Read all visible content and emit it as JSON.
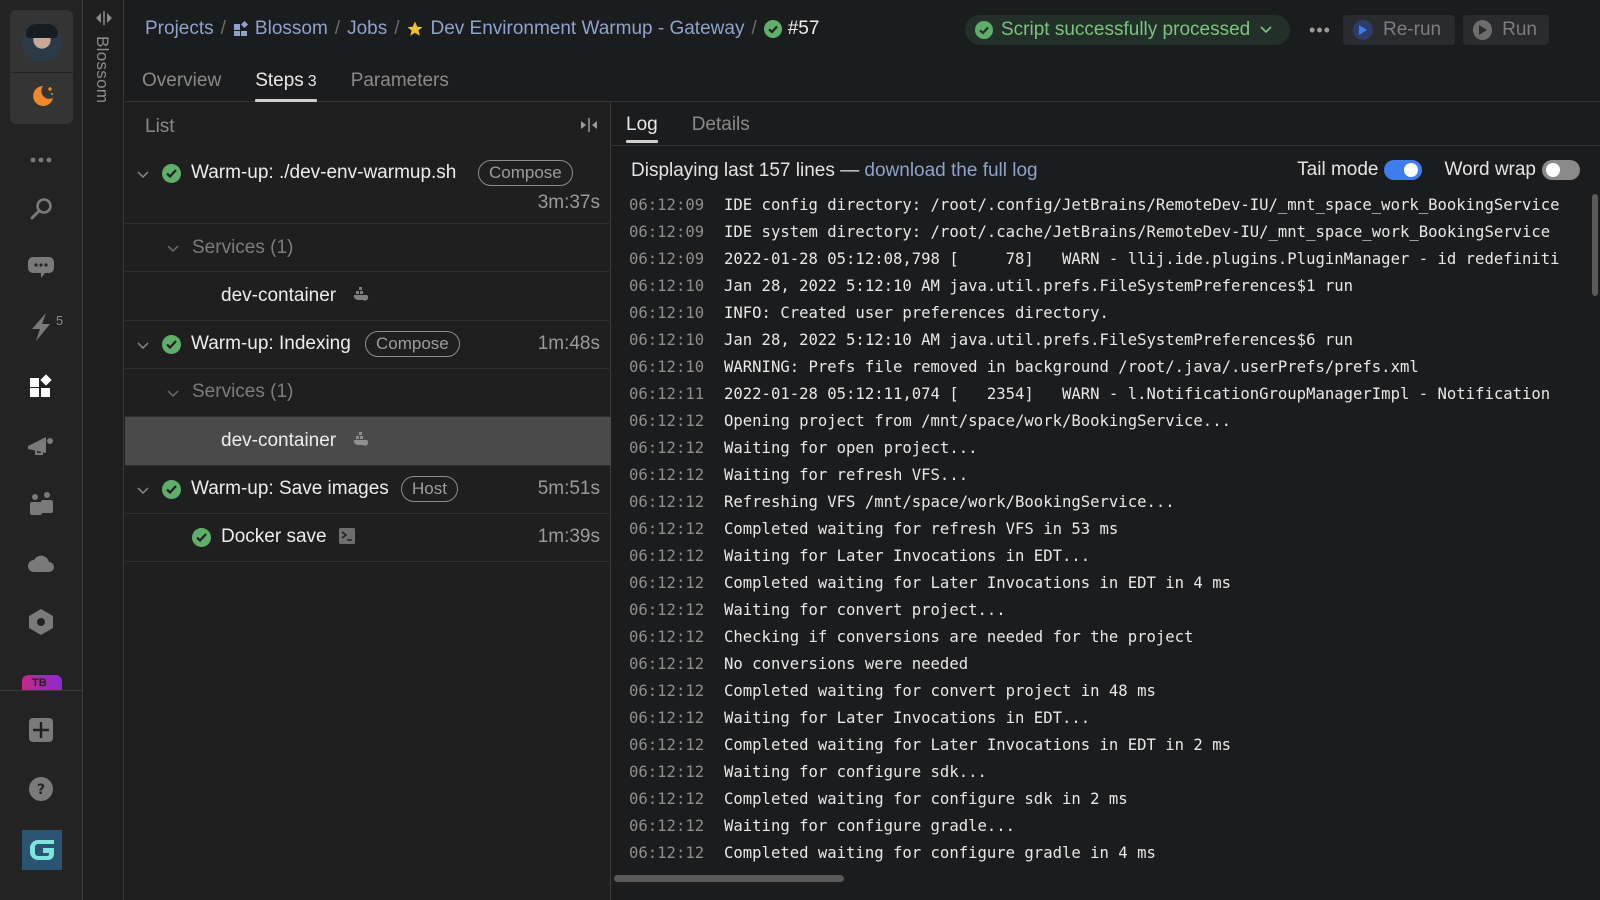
{
  "project_strip": {
    "label": "Blossom"
  },
  "rail": {
    "notifications_badge": "5",
    "tile_initials": "TB"
  },
  "header": {
    "breadcrumb": [
      "Projects",
      "Blossom",
      "Jobs",
      "Dev Environment Warmup - Gateway",
      "#57"
    ],
    "status": "Script successfully processed",
    "rerun_label": "Re-run",
    "run_label": "Run",
    "more_label": "•••"
  },
  "tabs": [
    {
      "label": "Overview"
    },
    {
      "label": "Steps",
      "count": "3"
    },
    {
      "label": "Parameters"
    }
  ],
  "list": {
    "header": "List",
    "steps": [
      {
        "title": "Warm-up: ./dev-env-warmup.sh",
        "tag": "Compose",
        "duration": "3m:37s",
        "services_label": "Services (1)",
        "service": "dev-container"
      },
      {
        "title": "Warm-up: Indexing",
        "tag": "Compose",
        "duration": "1m:48s",
        "services_label": "Services (1)",
        "service": "dev-container"
      },
      {
        "title": "Warm-up: Save images",
        "tag": "Host",
        "duration": "5m:51s",
        "substep": {
          "title": "Docker save",
          "duration": "1m:39s"
        }
      }
    ]
  },
  "log": {
    "tabs": [
      "Log",
      "Details"
    ],
    "info_prefix": "Displaying last 157 lines — ",
    "info_link": "download the full log",
    "tail_mode_label": "Tail mode",
    "tail_mode_on": true,
    "word_wrap_label": "Word wrap",
    "word_wrap_on": false,
    "lines": [
      {
        "ts": "06:12:09",
        "msg": "IDE config directory: /root/.config/JetBrains/RemoteDev-IU/_mnt_space_work_BookingService"
      },
      {
        "ts": "06:12:09",
        "msg": "IDE system directory: /root/.cache/JetBrains/RemoteDev-IU/_mnt_space_work_BookingService"
      },
      {
        "ts": "06:12:09",
        "msg": "2022-01-28 05:12:08,798 [     78]   WARN - llij.ide.plugins.PluginManager - id redefiniti"
      },
      {
        "ts": "06:12:10",
        "msg": "Jan 28, 2022 5:12:10 AM java.util.prefs.FileSystemPreferences$1 run"
      },
      {
        "ts": "06:12:10",
        "msg": "INFO: Created user preferences directory."
      },
      {
        "ts": "06:12:10",
        "msg": "Jan 28, 2022 5:12:10 AM java.util.prefs.FileSystemPreferences$6 run"
      },
      {
        "ts": "06:12:10",
        "msg": "WARNING: Prefs file removed in background /root/.java/.userPrefs/prefs.xml"
      },
      {
        "ts": "06:12:11",
        "msg": "2022-01-28 05:12:11,074 [   2354]   WARN - l.NotificationGroupManagerImpl - Notification"
      },
      {
        "ts": "06:12:12",
        "msg": "Opening project from /mnt/space/work/BookingService..."
      },
      {
        "ts": "06:12:12",
        "msg": "Waiting for open project..."
      },
      {
        "ts": "06:12:12",
        "msg": "Waiting for refresh VFS..."
      },
      {
        "ts": "06:12:12",
        "msg": "Refreshing VFS /mnt/space/work/BookingService..."
      },
      {
        "ts": "06:12:12",
        "msg": "Completed waiting for refresh VFS in 53 ms"
      },
      {
        "ts": "06:12:12",
        "msg": "Waiting for Later Invocations in EDT..."
      },
      {
        "ts": "06:12:12",
        "msg": "Completed waiting for Later Invocations in EDT in 4 ms"
      },
      {
        "ts": "06:12:12",
        "msg": "Waiting for convert project..."
      },
      {
        "ts": "06:12:12",
        "msg": "Checking if conversions are needed for the project"
      },
      {
        "ts": "06:12:12",
        "msg": "No conversions were needed"
      },
      {
        "ts": "06:12:12",
        "msg": "Completed waiting for convert project in 48 ms"
      },
      {
        "ts": "06:12:12",
        "msg": "Waiting for Later Invocations in EDT..."
      },
      {
        "ts": "06:12:12",
        "msg": "Completed waiting for Later Invocations in EDT in 2 ms"
      },
      {
        "ts": "06:12:12",
        "msg": "Waiting for configure sdk..."
      },
      {
        "ts": "06:12:12",
        "msg": "Completed waiting for configure sdk in 2 ms"
      },
      {
        "ts": "06:12:12",
        "msg": "Waiting for configure gradle..."
      },
      {
        "ts": "06:12:12",
        "msg": "Completed waiting for configure gradle in 4 ms"
      }
    ]
  },
  "colors": {
    "accent_blue": "#3f7cf0",
    "success_green": "#5faf6a",
    "link": "#8fa3cc",
    "star": "#f2c230",
    "moon": "#f0892a"
  }
}
